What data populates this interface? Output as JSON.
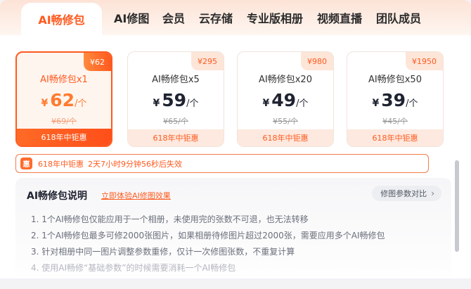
{
  "tabs": [
    {
      "label": "AI畅修包",
      "active": true
    },
    {
      "label": "AI修图"
    },
    {
      "label": "会员"
    },
    {
      "label": "云存储"
    },
    {
      "label": "专业版相册"
    },
    {
      "label": "视频直播"
    },
    {
      "label": "团队成员"
    }
  ],
  "cards": [
    {
      "badge": "¥62",
      "title": "AI畅修包x1",
      "currency": "¥",
      "price": "62",
      "unit": "/个",
      "original": "¥69/个",
      "promo": "618年中钜惠",
      "selected": true
    },
    {
      "badge": "¥295",
      "title": "AI畅修包x5",
      "currency": "¥",
      "price": "59",
      "unit": "/个",
      "original": "¥65/个",
      "promo": "618年中钜惠"
    },
    {
      "badge": "¥980",
      "title": "AI畅修包x20",
      "currency": "¥",
      "price": "49",
      "unit": "/个",
      "original": "¥55/个",
      "promo": "618年中钜惠"
    },
    {
      "badge": "¥1950",
      "title": "AI畅修包x50",
      "currency": "¥",
      "price": "39",
      "unit": "/个",
      "original": "¥45/个",
      "promo": "618年中钜惠"
    }
  ],
  "countdown": {
    "icon_char": "惠",
    "label": "618年中钜惠",
    "time": "2天7小时9分钟56秒后失效"
  },
  "info": {
    "title": "AI畅修包说明",
    "link": "立即体验AI修图效果",
    "compare_button": "修图参数对比",
    "items": [
      "1. 1个AI畅修包仅能应用于一个相册，未使用完的张数不可退，也无法转移",
      "2. 1个AI畅修包最多可修2000张图片，如果相册待修图片超过2000张，需要应用多个AI畅修包",
      "3. 针对相册中同一图片调整参数重修，仅计一次修图张数，不重复计算",
      "4. 使用AI畅修“基础参数”的时候需要消耗一个AI畅修包"
    ]
  },
  "colors": {
    "accent": "#ff5a1f",
    "accent_light": "#fde9df"
  }
}
